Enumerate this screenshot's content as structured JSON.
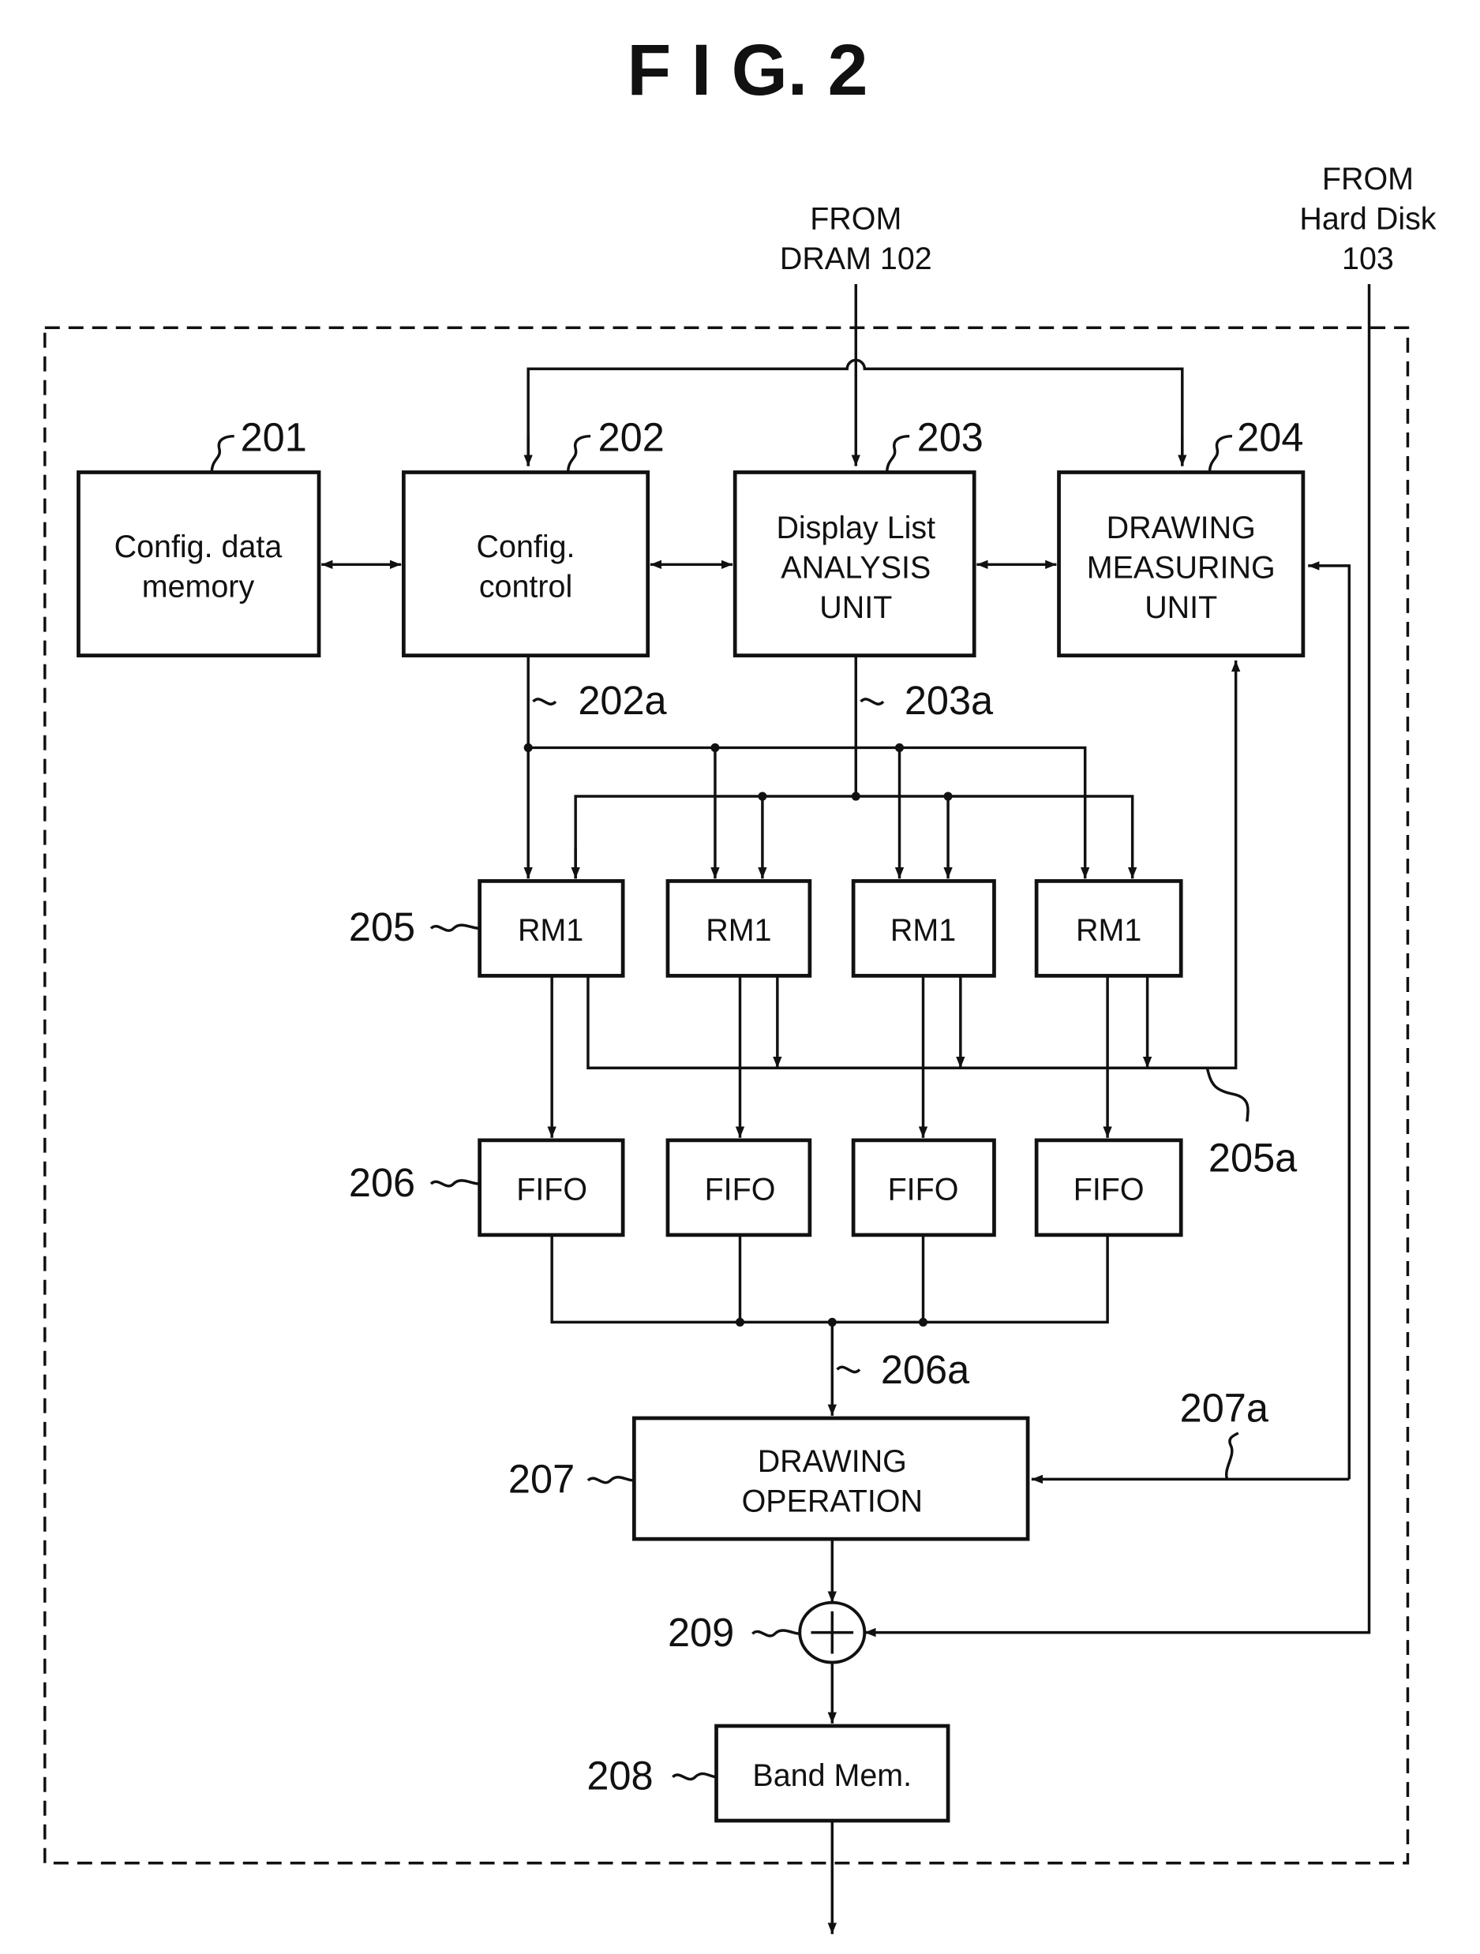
{
  "figure": {
    "title": "F I G. 2",
    "sources": {
      "dram": [
        "FROM",
        "DRAM 102"
      ],
      "hard_disk": [
        "FROM",
        "Hard Disk",
        "103"
      ]
    },
    "blocks": {
      "b201": {
        "ref": "201",
        "lines": [
          "Config. data",
          "memory"
        ]
      },
      "b202": {
        "ref": "202",
        "lines": [
          "Config.",
          "control"
        ]
      },
      "b203": {
        "ref": "203",
        "lines": [
          "Display List",
          "ANALYSIS",
          "UNIT"
        ]
      },
      "b204": {
        "ref": "204",
        "lines": [
          "DRAWING",
          "MEASURING",
          "UNIT"
        ]
      },
      "rm": {
        "ref": "205",
        "label": "RM1",
        "count": 4
      },
      "fifo": {
        "ref": "206",
        "label": "FIFO",
        "count": 4
      },
      "b207": {
        "ref": "207",
        "lines": [
          "DRAWING",
          "OPERATION"
        ]
      },
      "b208": {
        "ref": "208",
        "lines": [
          "Band Mem."
        ]
      },
      "b209": {
        "ref": "209",
        "symbol": "+"
      }
    },
    "bus_labels": {
      "b202a": "202a",
      "b203a": "203a",
      "b205a": "205a",
      "b206a": "206a",
      "b207a": "207a"
    }
  }
}
